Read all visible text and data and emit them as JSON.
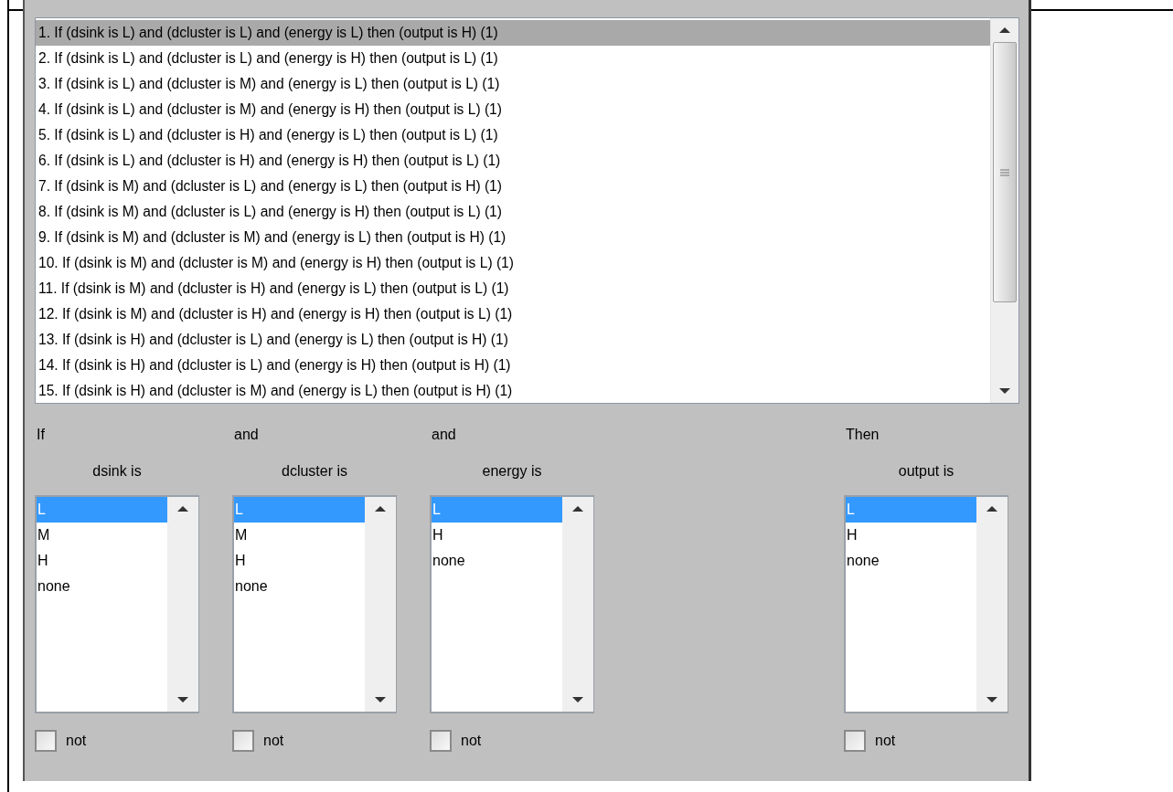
{
  "rules": [
    {
      "text": "1. If (dsink is L) and (dcluster is L) and (energy is L) then (output is H) (1)",
      "selected": true
    },
    {
      "text": "2. If (dsink is L) and (dcluster is L) and (energy is H) then (output is L) (1)",
      "selected": false
    },
    {
      "text": "3. If (dsink is L) and (dcluster is M) and (energy is L) then (output is L) (1)",
      "selected": false
    },
    {
      "text": "4. If (dsink is L) and (dcluster is M) and (energy is H) then (output is L) (1)",
      "selected": false
    },
    {
      "text": "5. If (dsink is L) and (dcluster is H) and (energy is L) then (output is L) (1)",
      "selected": false
    },
    {
      "text": "6. If (dsink is L) and (dcluster is H) and (energy is H) then (output is L) (1)",
      "selected": false
    },
    {
      "text": "7. If (dsink is M) and (dcluster is L) and (energy is L) then (output is H) (1)",
      "selected": false
    },
    {
      "text": "8. If (dsink is M) and (dcluster is L) and (energy is H) then (output is L) (1)",
      "selected": false
    },
    {
      "text": "9. If (dsink is M) and (dcluster is M) and (energy is L) then (output is H) (1)",
      "selected": false
    },
    {
      "text": "10. If (dsink is M) and (dcluster is M) and (energy is H) then (output is L) (1)",
      "selected": false
    },
    {
      "text": "11. If (dsink is M) and (dcluster is H) and (energy is L) then (output is L) (1)",
      "selected": false
    },
    {
      "text": "12. If (dsink is M) and (dcluster is H) and (energy is H) then (output is L) (1)",
      "selected": false
    },
    {
      "text": "13. If (dsink is H) and (dcluster is L) and (energy is L) then (output is H) (1)",
      "selected": false
    },
    {
      "text": "14. If (dsink is H) and (dcluster is L) and (energy is H) then (output is H) (1)",
      "selected": false
    },
    {
      "text": "15. If (dsink is H) and (dcluster is M) and (energy is L) then (output is H) (1)",
      "selected": false
    }
  ],
  "columns": [
    {
      "kind": "antecedent",
      "connector": "If",
      "label": "dsink is",
      "options": [
        {
          "text": "L",
          "selected": true
        },
        {
          "text": "M",
          "selected": false
        },
        {
          "text": "H",
          "selected": false
        },
        {
          "text": "none",
          "selected": false
        }
      ],
      "not": {
        "label": "not",
        "checked": false
      }
    },
    {
      "kind": "antecedent",
      "connector": "and",
      "label": "dcluster is",
      "options": [
        {
          "text": "L",
          "selected": true
        },
        {
          "text": "M",
          "selected": false
        },
        {
          "text": "H",
          "selected": false
        },
        {
          "text": "none",
          "selected": false
        }
      ],
      "not": {
        "label": "not",
        "checked": false
      }
    },
    {
      "kind": "antecedent",
      "connector": "and",
      "label": "energy is",
      "options": [
        {
          "text": "L",
          "selected": true
        },
        {
          "text": "H",
          "selected": false
        },
        {
          "text": "none",
          "selected": false
        }
      ],
      "not": {
        "label": "not",
        "checked": false
      }
    },
    {
      "kind": "consequent",
      "connector": "Then",
      "label": "output is",
      "options": [
        {
          "text": "L",
          "selected": true
        },
        {
          "text": "H",
          "selected": false
        },
        {
          "text": "none",
          "selected": false
        }
      ],
      "not": {
        "label": "not",
        "checked": false
      }
    }
  ]
}
